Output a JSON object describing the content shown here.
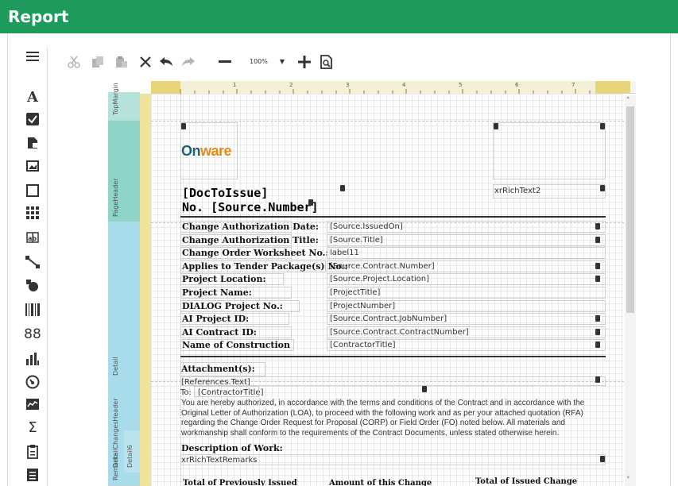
{
  "app": {
    "title": "Report"
  },
  "toolbar": {
    "zoom_value": "100%",
    "zoom_caret": "▼",
    "buttons": [
      "cut-icon",
      "copy-icon",
      "paste-icon",
      "delete-icon",
      "undo-icon",
      "redo-icon",
      "zoom-out-icon",
      "zoom-in-icon",
      "preview-icon"
    ]
  },
  "toolbox": {
    "items": [
      "menu-icon",
      "label-icon",
      "checkbox-icon",
      "rich-text-icon",
      "picture-box-icon",
      "panel-icon",
      "table-icon",
      "character-comb-icon",
      "line-icon",
      "shape-icon",
      "barcode-icon",
      "zip-code-icon",
      "chart-icon",
      "gauge-icon",
      "sparkline-icon",
      "summary-icon",
      "page-info-icon",
      "subreport-icon"
    ],
    "label_glyph": "A",
    "summary_glyph": "Σ"
  },
  "ruler": {
    "numbers": [
      "1",
      "2",
      "3",
      "4",
      "5",
      "6",
      "7"
    ]
  },
  "bands": [
    "TopMargin",
    "PageHeader",
    "Detail",
    "DetailChangesHeader",
    "Detail6",
    "Remarks"
  ],
  "header": {
    "logo_on": "On",
    "logo_ware": "ware",
    "doc_to_issue": "[DocToIssue]",
    "source_number": "No. [Source.Number]",
    "rich_text": "xrRichText2"
  },
  "detail": {
    "rows": [
      {
        "label": "Change Authorization Date:",
        "value": "[Source.IssuedOn]"
      },
      {
        "label": "Change Authorization Title:",
        "value": "[Source.Title]"
      },
      {
        "label": "Change Order Worksheet No.:",
        "value": "label11"
      },
      {
        "label": "Applies to Tender Package(s) No.:",
        "value": "[Source.Contract.Number]"
      },
      {
        "label": "Project Location:",
        "value": "[Source.Project.Location]"
      },
      {
        "label": "Project Name:",
        "value": "[ProjectTitle]"
      },
      {
        "label": "DIALOG Project No.:",
        "value": "[ProjectNumber]"
      },
      {
        "label": "AI Project ID:",
        "value": "[Source.Contract.JobNumber]"
      },
      {
        "label": "AI Contract ID:",
        "value": "[Source.Contract.ContractNumber]"
      },
      {
        "label": "Name of Construction",
        "value": "[ContractorTitle]"
      }
    ],
    "attachments_label": "Attachment(s):",
    "references": "[References.Text]"
  },
  "changes": {
    "to_prefix": "To:",
    "to_value": "[ContractorTitle]",
    "paragraph": [
      "You are hereby authorized, in accordance with the terms and conditions of the Contract and in accordance with the",
      "Original Letter of Authorization (LOA), to proceed with the following work and as per your attached quotation (RFA)",
      "regarding the Change Order Request for Proposal (CORP) or Field Order (FO) noted below. All materials and",
      "workmanship shall conform to the requirements of the Contract Documents, unless stated otherwise herein."
    ],
    "description_label": "Description of Work:",
    "remarks": "xrRichTextRemarks"
  },
  "footer_labels": [
    "Total of Previously Issued",
    "Amount of this Change",
    "Total of Issued Change"
  ],
  "colors": {
    "titlebar": "#1f9a5d",
    "pageheader_band": "#8fd4c9",
    "detail_band": "#a8dcea",
    "ruler_page": "#e6d57d"
  }
}
